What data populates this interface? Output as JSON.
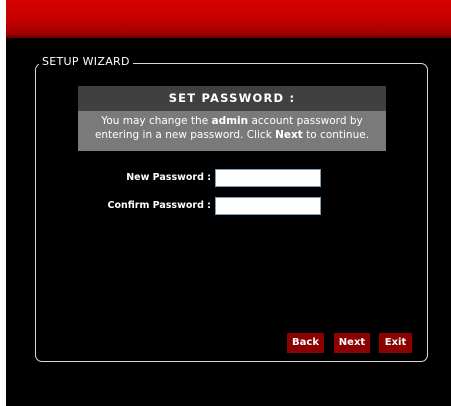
{
  "wizard": {
    "legend": "SETUP WIZARD",
    "title": "SET PASSWORD :",
    "info": {
      "part1": "You may change the ",
      "admin": "admin",
      "part2": " account password by entering in a new password. Click ",
      "next": "Next",
      "part3": " to continue."
    }
  },
  "form": {
    "new_password_label": "New Password :",
    "new_password_value": "",
    "confirm_password_label": "Confirm Password :",
    "confirm_password_value": ""
  },
  "buttons": {
    "back": "Back",
    "next": "Next",
    "exit": "Exit"
  },
  "colors": {
    "header": "#c20000",
    "background": "#000000",
    "button": "#8c0000",
    "title_bar": "#404040",
    "info_box": "#7a7a7a"
  }
}
